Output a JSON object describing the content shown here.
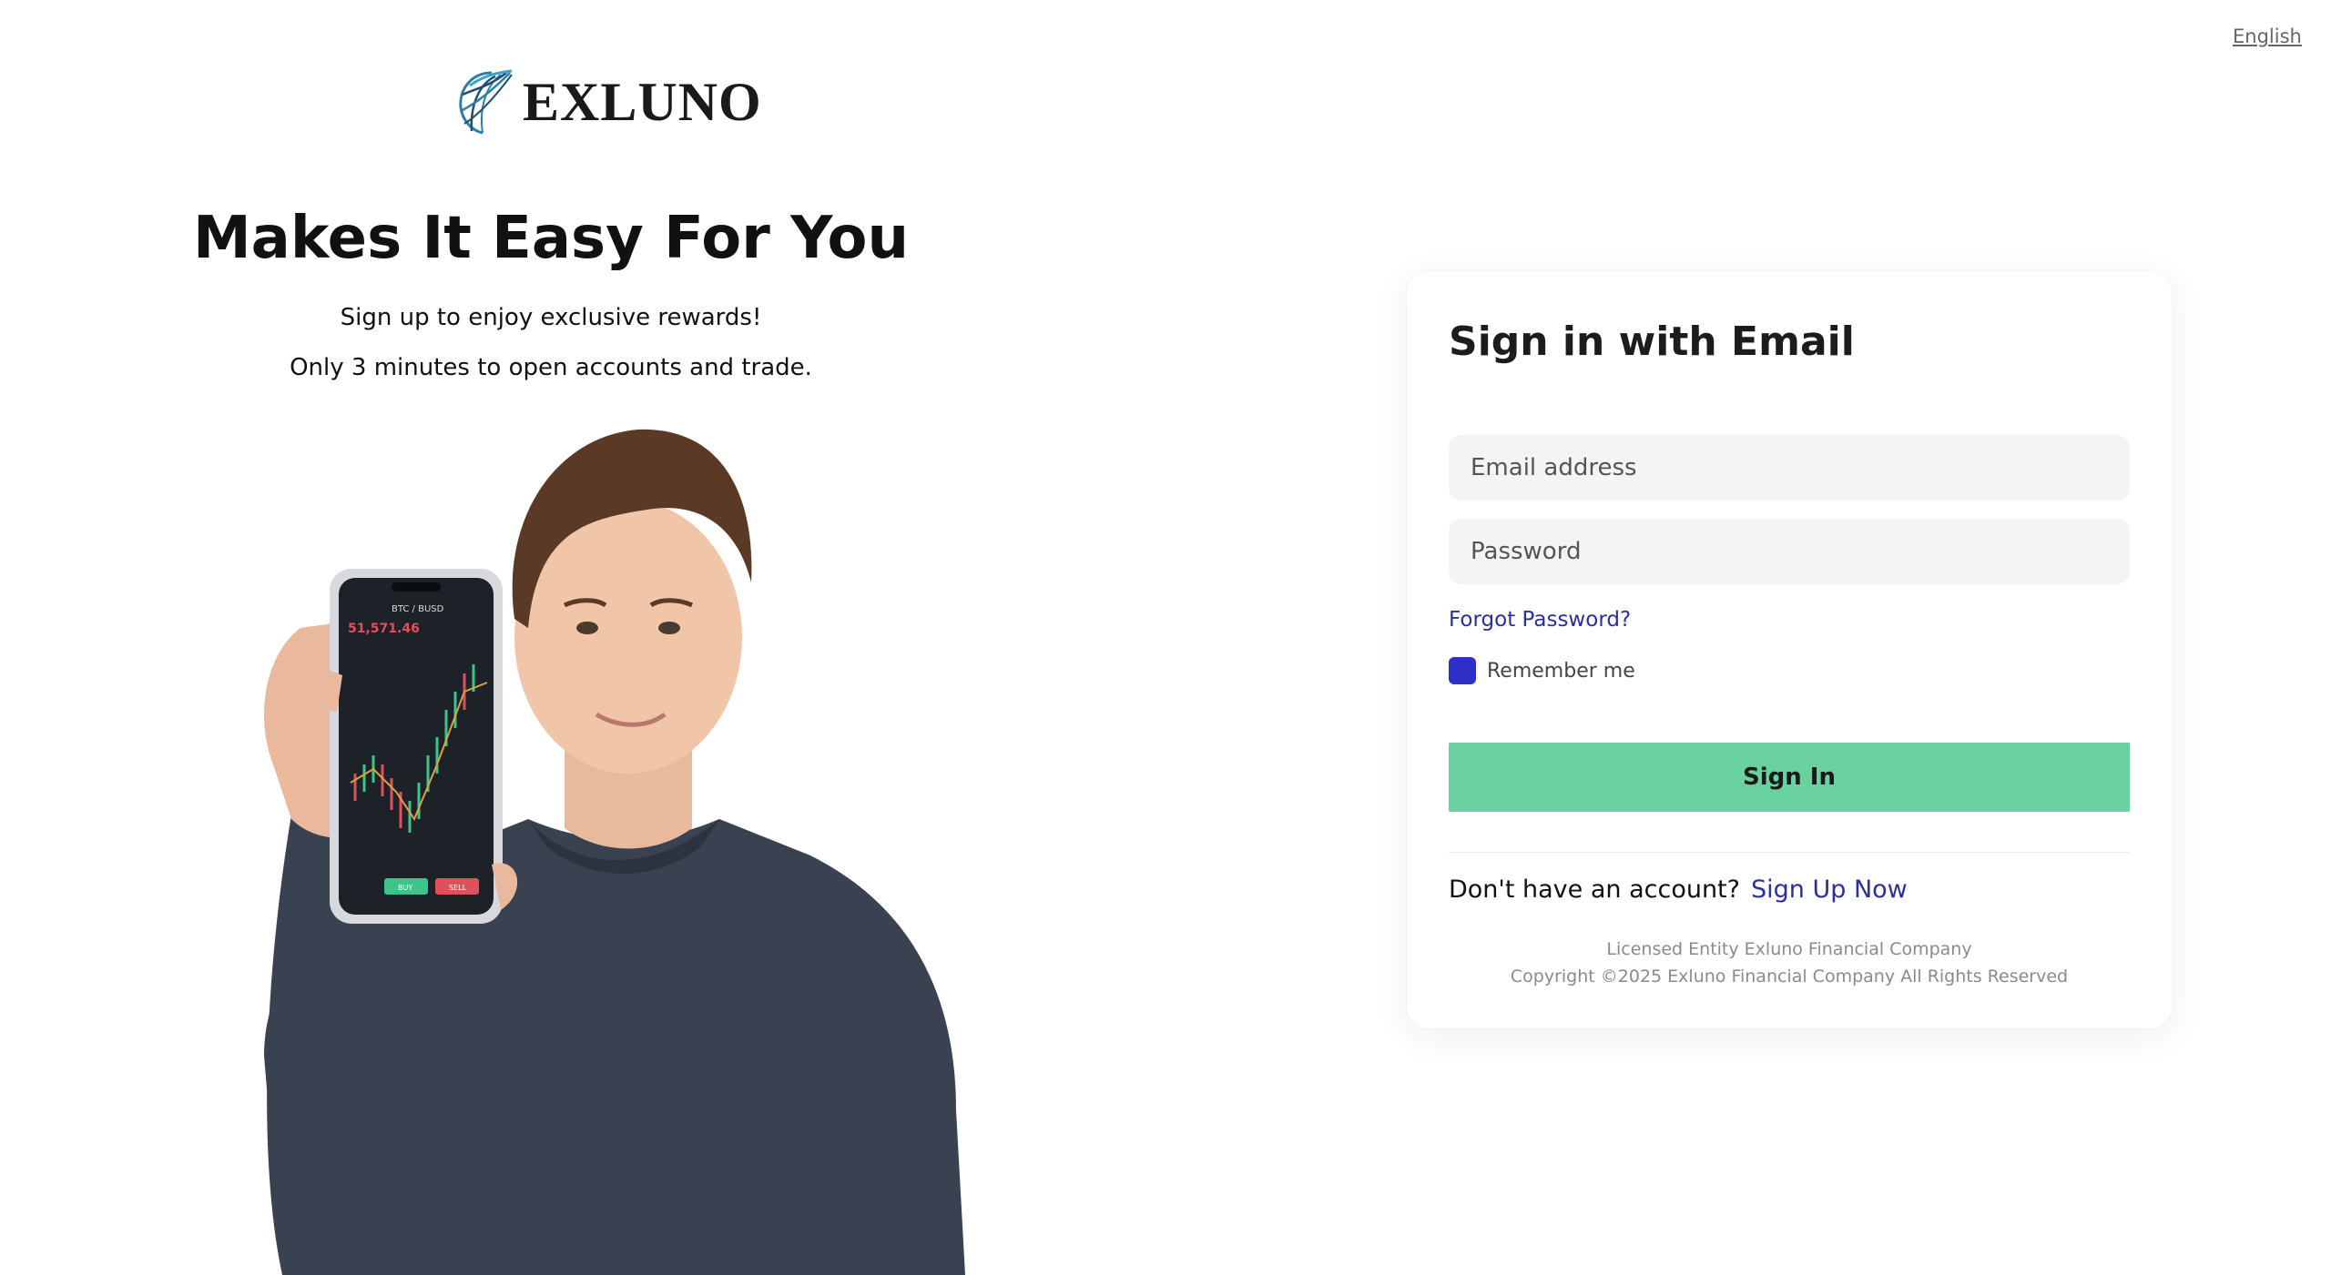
{
  "header": {
    "language": "English"
  },
  "brand": {
    "name": "EXLUNO"
  },
  "hero": {
    "title": "Makes It Easy For You",
    "subtitle_1": "Sign up to enjoy exclusive rewards!",
    "subtitle_2": "Only 3 minutes to open accounts and trade.",
    "phone": {
      "pair": "BTC / BUSD",
      "price": "51,571.46",
      "buy_label": "BUY",
      "sell_label": "SELL"
    }
  },
  "signin": {
    "title": "Sign in with Email",
    "email_placeholder": "Email address",
    "password_placeholder": "Password",
    "forgot_label": "Forgot Password?",
    "remember_label": "Remember me",
    "remember_checked": true,
    "button_label": "Sign In",
    "no_account_text": "Don't have an account?",
    "signup_label": "Sign Up Now",
    "legal_line_1": "Licensed Entity Exluno Financial Company",
    "legal_line_2": "Copyright ©2025 Exluno Financial Company All Rights Reserved"
  },
  "colors": {
    "accent_button": "#69d29f",
    "link": "#2a2f9e",
    "checkbox": "#2e2fc7",
    "field_bg": "#f3f4f6"
  }
}
